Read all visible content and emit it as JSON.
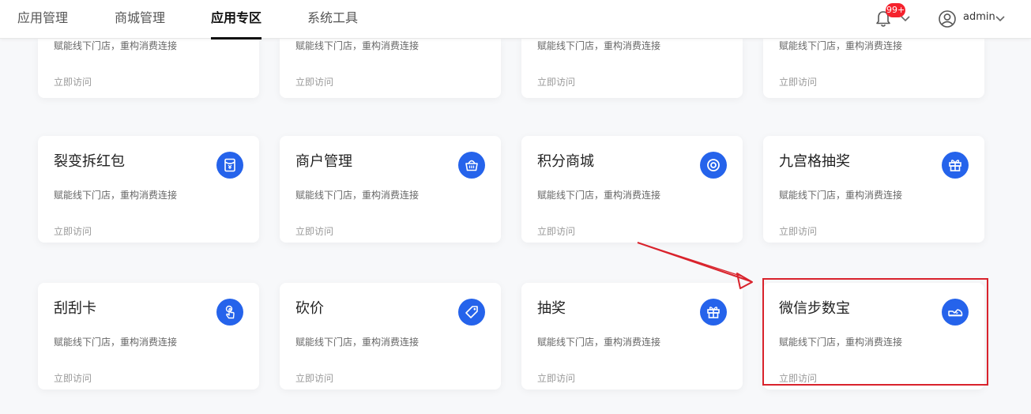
{
  "nav": {
    "tabs": [
      "应用管理",
      "商城管理",
      "应用专区",
      "系统工具"
    ],
    "active_index": 2
  },
  "header": {
    "notification_count": "99+",
    "username": "admin"
  },
  "cards_top_partial": [
    {
      "desc": "赋能线下门店，重构消费连接",
      "link": "立即访问"
    },
    {
      "desc": "赋能线下门店，重构消费连接",
      "link": "立即访问"
    },
    {
      "desc": "赋能线下门店，重构消费连接",
      "link": "立即访问"
    },
    {
      "desc": "赋能线下门店，重构消费连接",
      "link": "立即访问"
    }
  ],
  "cards": [
    {
      "title": "裂变拆红包",
      "desc": "赋能线下门店，重构消费连接",
      "link": "立即访问",
      "icon": "red-envelope-icon"
    },
    {
      "title": "商户管理",
      "desc": "赋能线下门店，重构消费连接",
      "link": "立即访问",
      "icon": "shop-basket-icon"
    },
    {
      "title": "积分商城",
      "desc": "赋能线下门店，重构消费连接",
      "link": "立即访问",
      "icon": "points-target-icon"
    },
    {
      "title": "九宫格抽奖",
      "desc": "赋能线下门店，重构消费连接",
      "link": "立即访问",
      "icon": "gift-icon"
    },
    {
      "title": "刮刮卡",
      "desc": "赋能线下门店，重构消费连接",
      "link": "立即访问",
      "icon": "hand-tap-icon"
    },
    {
      "title": "砍价",
      "desc": "赋能线下门店，重构消费连接",
      "link": "立即访问",
      "icon": "price-tag-icon"
    },
    {
      "title": "抽奖",
      "desc": "赋能线下门店，重构消费连接",
      "link": "立即访问",
      "icon": "gift-icon"
    },
    {
      "title": "微信步数宝",
      "desc": "赋能线下门店，重构消费连接",
      "link": "立即访问",
      "icon": "sneaker-icon"
    }
  ],
  "colors": {
    "accent": "#2563eb",
    "annotation": "#d9232c",
    "badge": "#f5222d"
  }
}
